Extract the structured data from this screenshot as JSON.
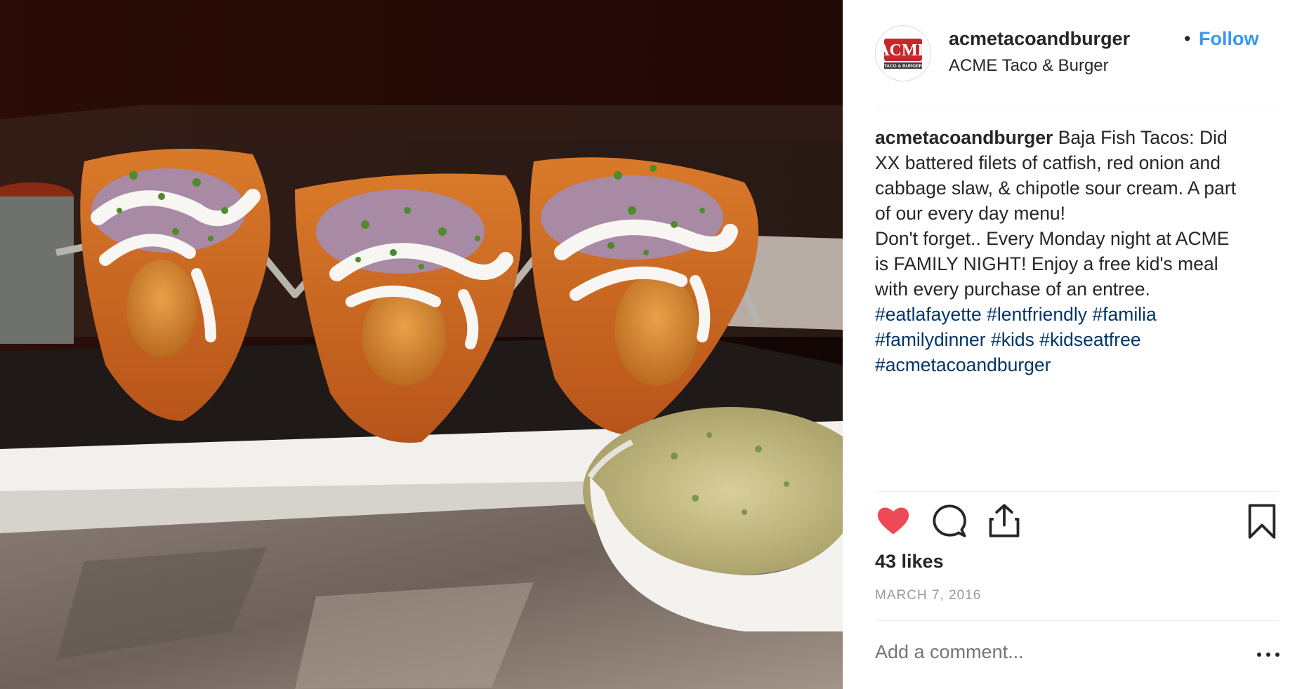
{
  "post": {
    "username": "acmetacoandburger",
    "separator": "•",
    "follow_label": "Follow",
    "location": "ACME Taco & Burger",
    "avatar_logo": {
      "main": "ACME",
      "sub": "TACO & BURGER"
    },
    "caption": {
      "username": "acmetacoandburger",
      "lines": [
        "Baja Fish Tacos: Did",
        "XX battered filets of catfish, red onion and",
        "cabbage slaw, & chipotle sour cream. A part",
        "of our every day menu!",
        "Don't forget.. Every Monday night at ACME",
        "is FAMILY NIGHT! Enjoy a free kid's meal",
        "with every purchase of an entree."
      ],
      "hashtags": [
        [
          "#eatlafayette",
          "#lentfriendly",
          "#familia"
        ],
        [
          "#familydinner",
          "#kids",
          "#kidseatfree"
        ],
        [
          "#acmetacoandburger"
        ]
      ]
    },
    "likes_text": "43 likes",
    "date": "MARCH 7, 2016",
    "comment_placeholder": "Add a comment..."
  },
  "icons": {
    "like": "heart-filled-icon",
    "comment": "comment-bubble-icon",
    "share": "share-upload-icon",
    "save": "bookmark-icon",
    "more": "ellipsis-icon"
  },
  "colors": {
    "follow": "#3897f0",
    "hashtag": "#003569",
    "like_heart": "#ed4956",
    "muted_text": "#999999",
    "divider": "#efefef",
    "logo_red": "#c8262d"
  }
}
